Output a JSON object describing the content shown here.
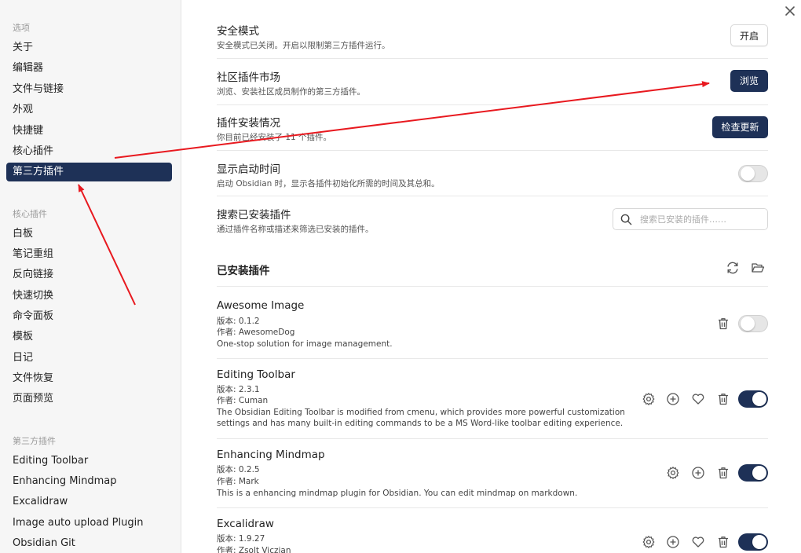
{
  "sidebar": {
    "options_title": "选项",
    "options": [
      "关于",
      "编辑器",
      "文件与链接",
      "外观",
      "快捷键",
      "核心插件",
      "第三方插件"
    ],
    "core_title": "核心插件",
    "core": [
      "白板",
      "笔记重组",
      "反向链接",
      "快速切换",
      "命令面板",
      "模板",
      "日记",
      "文件恢复",
      "页面预览"
    ],
    "third_title": "第三方插件",
    "third": [
      "Editing Toolbar",
      "Enhancing Mindmap",
      "Excalidraw",
      "Image auto upload Plugin",
      "Obsidian Git"
    ]
  },
  "settings": {
    "safe_mode": {
      "title": "安全模式",
      "desc": "安全模式已关闭。开启以限制第三方插件运行。",
      "button": "开启"
    },
    "community": {
      "title": "社区插件市场",
      "desc": "浏览、安装社区成员制作的第三方插件。",
      "button": "浏览"
    },
    "installed_status": {
      "title": "插件安装情况",
      "desc": "你目前已经安装了 11 个插件。",
      "button": "检查更新"
    },
    "startup_time": {
      "title": "显示启动时间",
      "desc": "启动 Obsidian 时，显示各插件初始化所需的时间及其总和。",
      "enabled": false
    },
    "search": {
      "title": "搜索已安装插件",
      "desc": "通过插件名称或描述来筛选已安装的插件。",
      "placeholder": "搜索已安装的插件……"
    }
  },
  "installed": {
    "heading": "已安装插件",
    "plugins": [
      {
        "name": "Awesome Image",
        "version": "版本: 0.1.2",
        "author": "作者: AwesomeDog",
        "desc": [
          "One-stop solution for image management."
        ],
        "enabled": false
      },
      {
        "name": "Editing Toolbar",
        "version": "版本: 2.3.1",
        "author": "作者: Cuman",
        "desc": [
          "The Obsidian Editing Toolbar is modified from cmenu, which provides more powerful customization",
          "settings and has many built-in editing commands to be a MS Word-like toolbar editing experience."
        ],
        "enabled": true
      },
      {
        "name": "Enhancing Mindmap",
        "version": "版本: 0.2.5",
        "author": "作者: Mark",
        "desc": [
          "This is a enhancing mindmap plugin for Obsidian. You can edit mindmap on markdown."
        ],
        "enabled": true
      },
      {
        "name": "Excalidraw",
        "version": "版本: 1.9.27",
        "author": "作者: Zsolt Viczian",
        "desc": [],
        "enabled": true
      }
    ]
  },
  "colors": {
    "accent": "#1e3157",
    "annotation": "#e8191f"
  }
}
